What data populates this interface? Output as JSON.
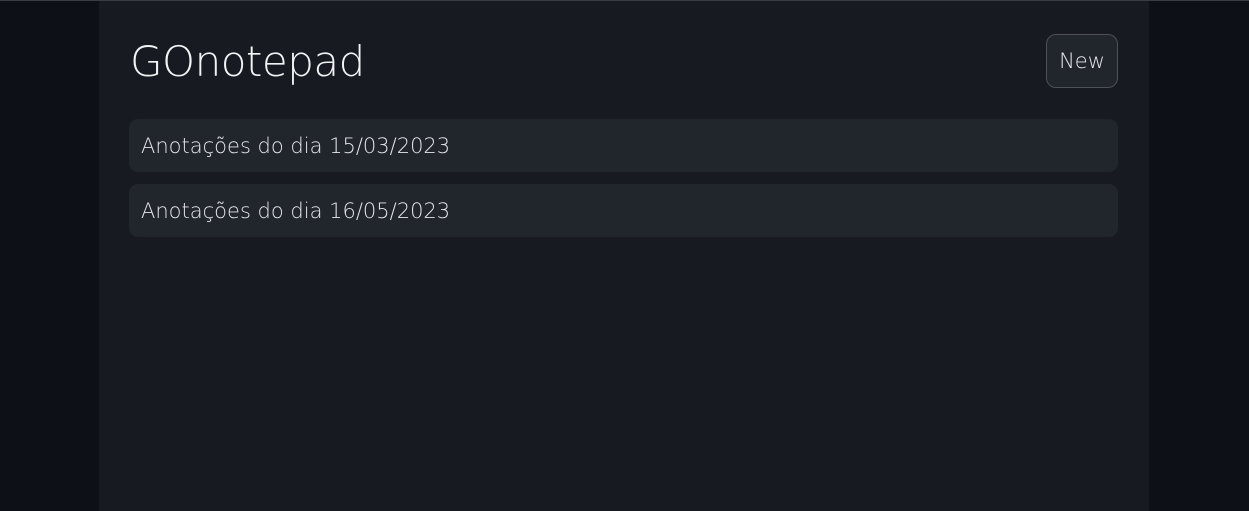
{
  "app": {
    "title": "GOnotepad",
    "new_label": "New"
  },
  "notes": [
    {
      "title": "Anotações do dia 15/03/2023"
    },
    {
      "title": "Anotações do dia 16/05/2023"
    }
  ]
}
